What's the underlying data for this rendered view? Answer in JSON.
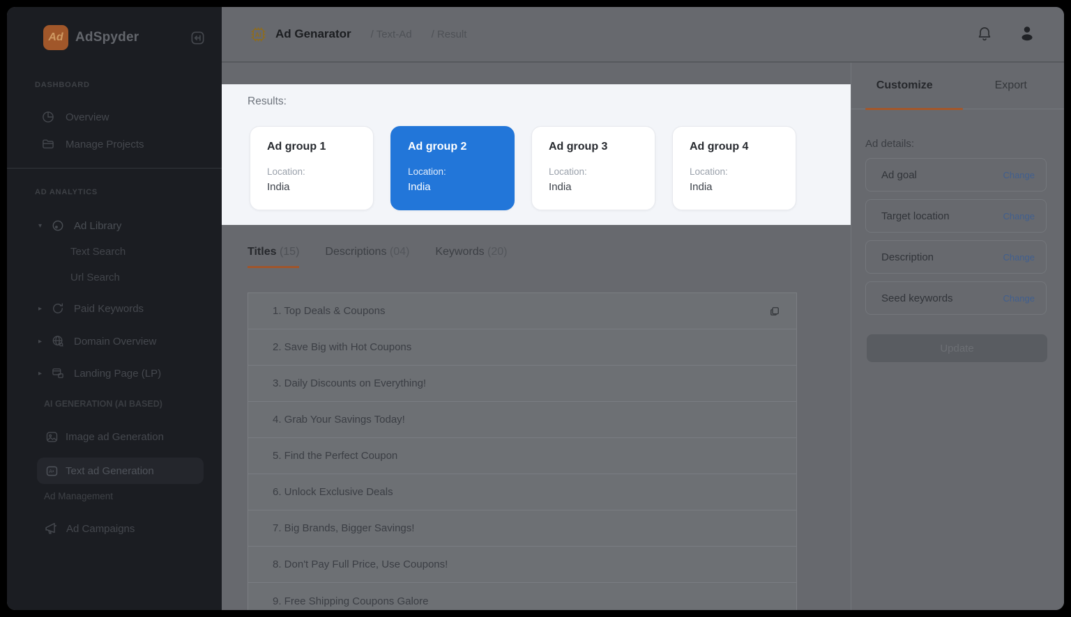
{
  "app": {
    "name": "AdSpyder"
  },
  "header": {
    "title": "Ad Genarator",
    "crumb_textad": "/ Text-Ad",
    "crumb_result": "/ Result"
  },
  "sidebar": {
    "labels": {
      "dashboard": "DASHBOARD",
      "ad_analytics": "AD ANALYTICS",
      "ai_generation": "AI GENERATION (AI BASED)",
      "ad_management": "Ad Management"
    },
    "items": {
      "overview": "Overview",
      "manage_projects": "Manage Projects",
      "ad_library": "Ad Library",
      "text_search": "Text Search",
      "url_search": "Url Search",
      "paid_keywords": "Paid Keywords",
      "domain_overview": "Domain Overview",
      "landing_page": "Landing Page (LP)",
      "image_ad_generation": "Image ad Generation",
      "text_ad_generation": "Text ad Generation",
      "ad_campaigns": "Ad Campaigns"
    }
  },
  "results": {
    "label": "Results:",
    "groups": [
      {
        "name": "Ad group 1",
        "location_label": "Location:",
        "location": "India",
        "selected": false
      },
      {
        "name": "Ad group 2",
        "location_label": "Location:",
        "location": "India",
        "selected": true
      },
      {
        "name": "Ad group 3",
        "location_label": "Location:",
        "location": "India",
        "selected": false
      },
      {
        "name": "Ad group 4",
        "location_label": "Location:",
        "location": "India",
        "selected": false
      }
    ]
  },
  "tabs": {
    "titles_label": "Titles",
    "titles_count": "(15)",
    "descriptions_label": "Descriptions",
    "descriptions_count": "(04)",
    "keywords_label": "Keywords",
    "keywords_count": "(20)"
  },
  "titles_list": [
    "1. Top Deals & Coupons",
    "2. Save Big with Hot Coupons",
    "3. Daily Discounts on Everything!",
    "4. Grab Your Savings Today!",
    "5. Find the Perfect Coupon",
    "6. Unlock Exclusive Deals",
    "7. Big Brands, Bigger Savings!",
    "8. Don't Pay Full Price, Use Coupons!",
    "9. Free Shipping Coupons Galore"
  ],
  "panel": {
    "tab_customize": "Customize",
    "tab_export": "Export",
    "ad_details_label": "Ad details:",
    "rows": [
      {
        "label": "Ad goal",
        "action": "Change"
      },
      {
        "label": "Target location",
        "action": "Change"
      },
      {
        "label": "Description",
        "action": "Change"
      },
      {
        "label": "Seed keywords",
        "action": "Change"
      }
    ],
    "update_label": "Update"
  },
  "colors": {
    "brand_orange": "#e8762d",
    "selected_card_blue": "#2276d9",
    "change_link_blue": "#4b74b8"
  }
}
